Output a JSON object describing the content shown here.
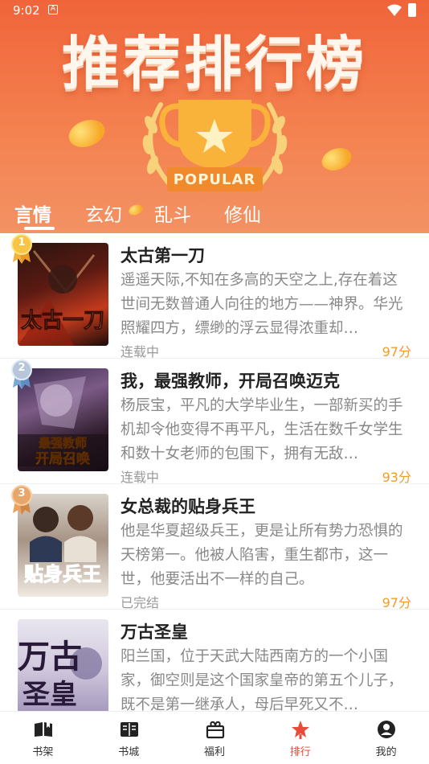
{
  "status_bar": {
    "time": "9:02",
    "notification_icon": "A"
  },
  "banner": {
    "title": "推荐排行榜",
    "badge": "POPULAR"
  },
  "tabs": [
    {
      "label": "言情",
      "active": true
    },
    {
      "label": "玄幻",
      "active": false
    },
    {
      "label": "乱斗",
      "active": false
    },
    {
      "label": "修仙",
      "active": false
    }
  ],
  "books": [
    {
      "rank": "1",
      "title": "太古第一刀",
      "description": "遥遥天际,不知在多高的天空之上,存在着这世间无数普通人向往的地方——神界。华光照耀四方，缥缈的浮云显得浓重却…",
      "status": "连载中",
      "score": "97分",
      "cover_text": "太古第一刀"
    },
    {
      "rank": "2",
      "title": "我，最强教师，开局召唤迈克",
      "description": "杨辰宝，平凡的大学毕业生，一部新买的手机却令他变得不再平凡，生活在数千女学生和数十女老师的包围下，拥有无敌…",
      "status": "连载中",
      "score": "93分",
      "cover_text": "我最强教师开局召唤"
    },
    {
      "rank": "3",
      "title": "女总裁的贴身兵王",
      "description": "他是华夏超级兵王，更是让所有势力恐惧的天榜第一。他被人陷害，重生都市，这一世，他要活出不一样的自己。",
      "status": "已完结",
      "score": "97分",
      "cover_text": "贴身兵王"
    },
    {
      "rank": "",
      "title": "万古圣皇",
      "description": "阳兰国，位于天武大陆西南方的一个小国家，御空则是这个国家皇帝的第五个儿子，既不是第一继承人，母后早死又不…",
      "status": "",
      "score": "",
      "cover_text": "万古圣皇"
    }
  ],
  "nav": [
    {
      "label": "书架",
      "icon": "bookshelf-icon",
      "active": false
    },
    {
      "label": "书城",
      "icon": "book-open-icon",
      "active": false
    },
    {
      "label": "福利",
      "icon": "gift-icon",
      "active": false
    },
    {
      "label": "排行",
      "icon": "star-rank-icon",
      "active": true
    },
    {
      "label": "我的",
      "icon": "user-icon",
      "active": false
    }
  ],
  "colors": {
    "accent": "#e84b3a",
    "banner": "#f0643a",
    "score": "#f39b2a"
  }
}
